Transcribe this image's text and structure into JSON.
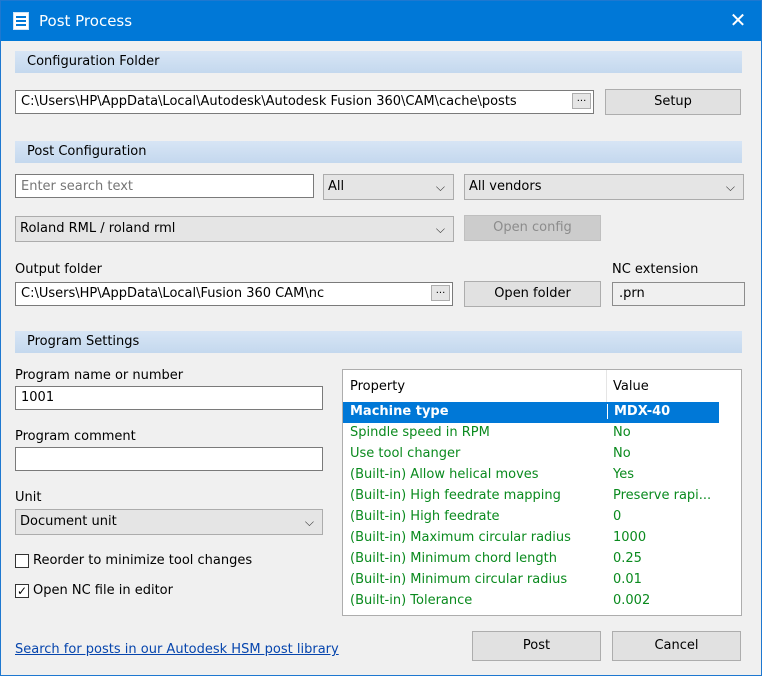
{
  "window": {
    "title": "Post Process",
    "close_label": "✕"
  },
  "config_folder": {
    "section_title": "Configuration Folder",
    "path": "C:\\Users\\HP\\AppData\\Local\\Autodesk\\Autodesk Fusion 360\\CAM\\cache\\posts",
    "browse_label": "...",
    "setup_label": "Setup"
  },
  "post_config": {
    "section_title": "Post Configuration",
    "search_placeholder": "Enter search text",
    "filter_value": "All",
    "vendor_value": "All vendors",
    "post_value": "Roland RML / roland rml",
    "open_config_label": "Open config",
    "output_folder_label": "Output folder",
    "output_folder_path": "C:\\Users\\HP\\AppData\\Local\\Fusion 360 CAM\\nc",
    "browse_label": "...",
    "open_folder_label": "Open folder",
    "nc_extension_label": "NC extension",
    "nc_extension_value": ".prn"
  },
  "program_settings": {
    "section_title": "Program Settings",
    "name_label": "Program name or number",
    "name_value": "1001",
    "comment_label": "Program comment",
    "comment_value": "",
    "unit_label": "Unit",
    "unit_value": "Document unit",
    "reorder_label": "Reorder to minimize tool changes",
    "reorder_checked": false,
    "open_nc_label": "Open NC file in editor",
    "open_nc_checked": true
  },
  "properties": {
    "headers": [
      "Property",
      "Value"
    ],
    "rows": [
      {
        "property": "Machine type",
        "value": "MDX-40"
      },
      {
        "property": "Spindle speed in RPM",
        "value": "No"
      },
      {
        "property": "Use tool changer",
        "value": "No"
      },
      {
        "property": "(Built-in) Allow helical moves",
        "value": "Yes"
      },
      {
        "property": "(Built-in) High feedrate mapping",
        "value": "Preserve rapi..."
      },
      {
        "property": "(Built-in) High feedrate",
        "value": "0"
      },
      {
        "property": "(Built-in) Maximum circular radius",
        "value": "1000"
      },
      {
        "property": "(Built-in) Minimum chord length",
        "value": "0.25"
      },
      {
        "property": "(Built-in) Minimum circular radius",
        "value": "0.01"
      },
      {
        "property": "(Built-in) Tolerance",
        "value": "0.002"
      }
    ]
  },
  "footer": {
    "library_link": "Search for posts in our Autodesk HSM post library",
    "post_label": "Post",
    "cancel_label": "Cancel"
  },
  "colors": {
    "title_bar": "#0078d7",
    "selected_row": "#0078d7",
    "property_text": "#0a8a1e",
    "link": "#0645ad"
  }
}
